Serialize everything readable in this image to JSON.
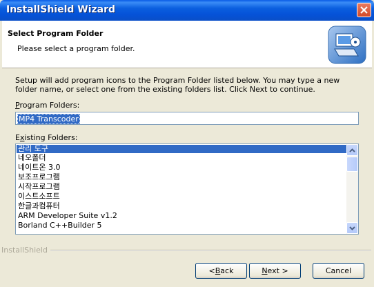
{
  "window": {
    "title": "InstallShield Wizard"
  },
  "header": {
    "title": "Select Program Folder",
    "subtitle": "Please select a program folder."
  },
  "body": {
    "description": "Setup will add program icons to the Program Folder listed below.  You may type a new folder name, or select one from the existing folders list.  Click Next to continue."
  },
  "program_folder": {
    "label_prefix": "",
    "label_accel": "P",
    "label_rest": "rogram Folders:",
    "value": "MP4 Transcoder"
  },
  "existing_folders": {
    "label_prefix": "E",
    "label_accel": "x",
    "label_rest": "isting Folders:",
    "items": [
      "관리 도구",
      "네오폴더",
      "네이트온 3.0",
      "보조프로그램",
      "시작프로그램",
      "이스트소프트",
      "한글과컴퓨터",
      "ARM Developer Suite v1.2",
      "Borland C++Builder 5"
    ],
    "selected_index": 0
  },
  "brand": "InstallShield",
  "buttons": {
    "back_accel": "B",
    "back_prefix": "< ",
    "back_rest": "ack",
    "next_accel": "N",
    "next_rest": "ext >",
    "cancel": "Cancel"
  },
  "colors": {
    "title_bar": "#0a5ce6",
    "selection": "#316ac5",
    "close_button": "#d34a2a"
  }
}
